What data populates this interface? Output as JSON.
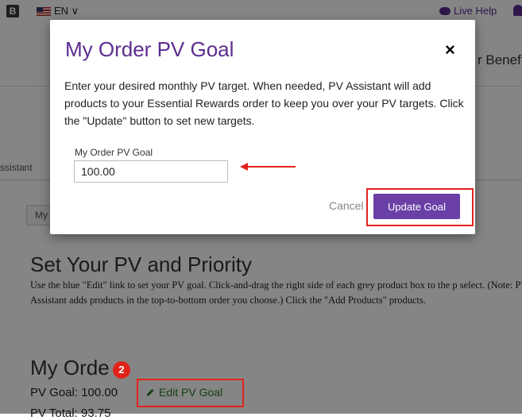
{
  "topbar": {
    "logo_glyph": "B",
    "language": "EN ∨",
    "live_help": "Live Help"
  },
  "header": {
    "partial_title": "r Benef"
  },
  "tabs": {
    "assistant": "ssistant",
    "my_tab": "My"
  },
  "background": {
    "heading": "Set Your PV and Priority",
    "description": "Use the blue \"Edit\" link to set your PV goal. Click-and-drag the right side of each grey product box to the p select. (Note: PV Assistant adds products in the top-to-bottom order you choose.) Click the \"Add Products\" products.",
    "my_order_heading": "My Orde",
    "pv_goal": "PV Goal: 100.00",
    "edit_link": "Edit PV Goal",
    "pv_total": "PV Total: 93.75"
  },
  "modal": {
    "title": "My Order PV Goal",
    "close": "×",
    "body": "Enter your desired monthly PV target. When needed, PV Assistant will add products to your Essential Rewards order to keep you over your PV targets. Click the \"Update\" button to set new targets.",
    "field_label": "My Order PV Goal",
    "field_value": "100.00",
    "cancel": "Cancel",
    "update": "Update Goal"
  },
  "annotation": {
    "badge": "2"
  },
  "colors": {
    "accent": "#5c2d91",
    "button": "#6a3fa6",
    "highlight": "#e2231a",
    "edit_link": "#2a7a2a"
  }
}
